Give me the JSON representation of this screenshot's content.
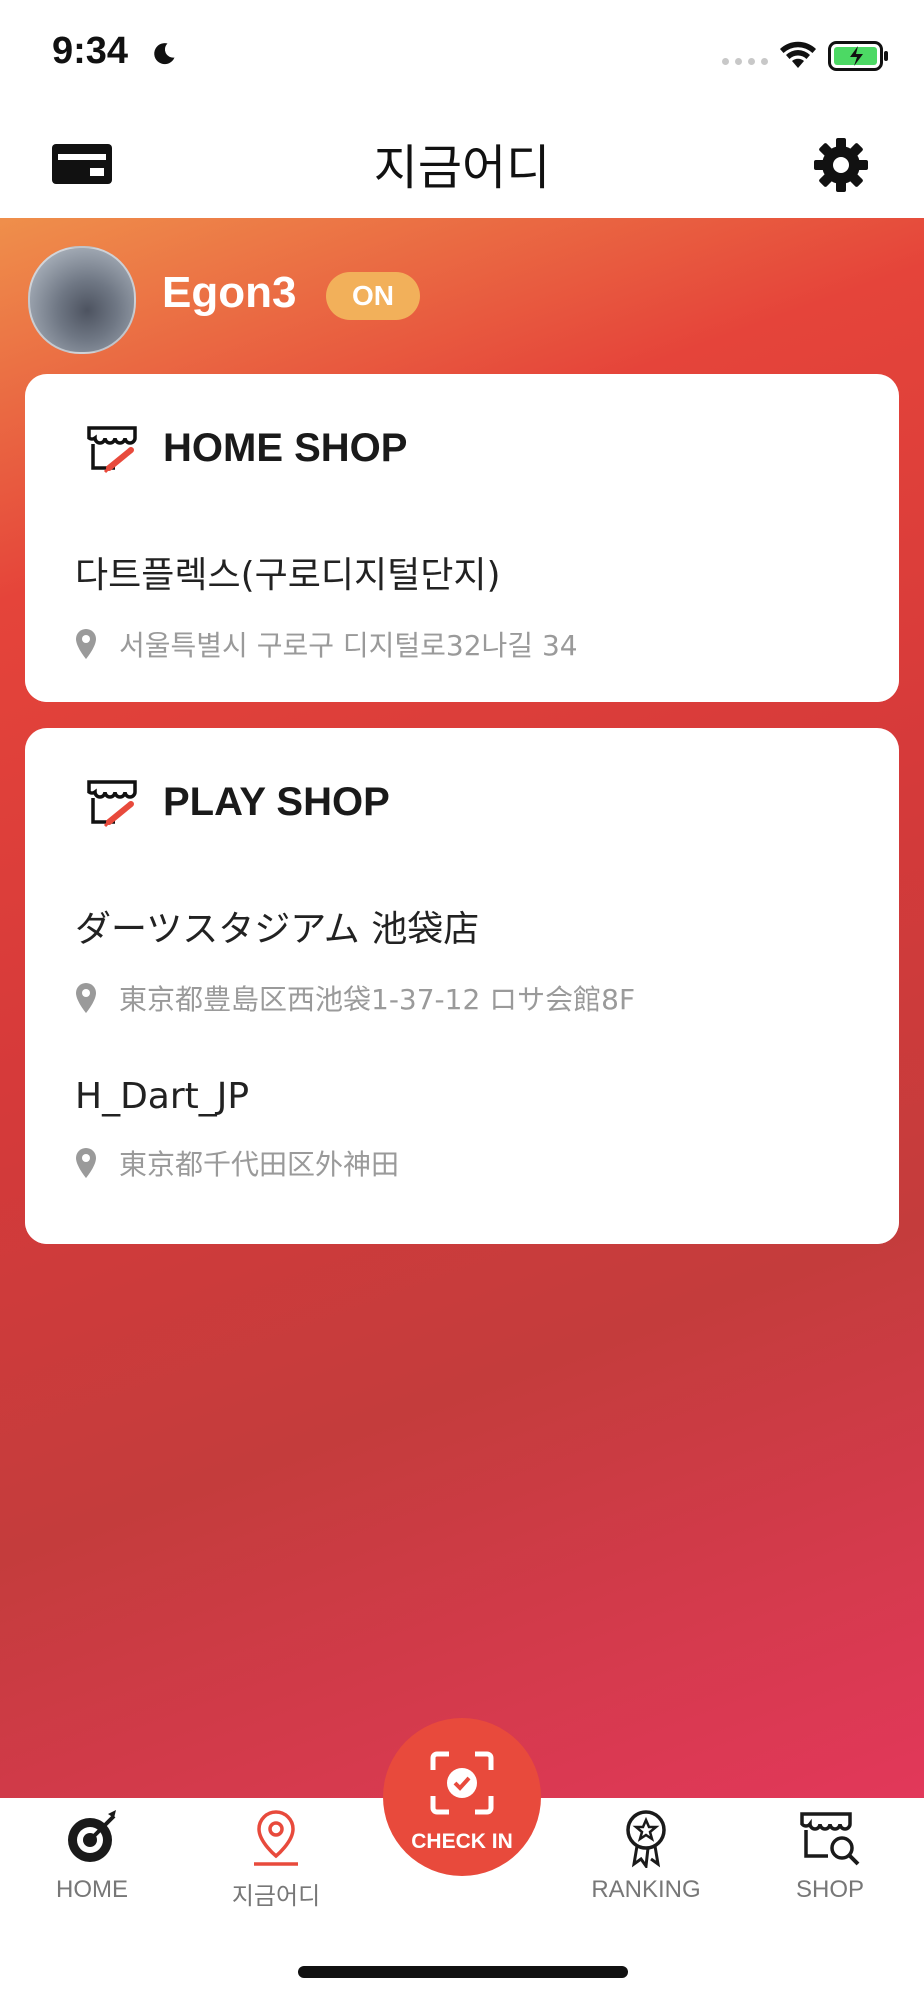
{
  "status_bar": {
    "time": "9:34"
  },
  "header": {
    "title": "지금어디"
  },
  "profile": {
    "username": "Egon3",
    "status_badge": "ON"
  },
  "home_shop": {
    "title": "HOME SHOP",
    "entries": [
      {
        "name": "다트플렉스(구로디지털단지)",
        "address": "서울특별시 구로구 디지털로32나길 34"
      }
    ]
  },
  "play_shop": {
    "title": "PLAY SHOP",
    "entries": [
      {
        "name": "ダーツスタジアム 池袋店",
        "address": "東京都豊島区西池袋1-37-12 ロサ会館8F"
      },
      {
        "name": "H_Dart_JP",
        "address": "東京都千代田区外神田"
      }
    ]
  },
  "bottom_nav": {
    "home": "HOME",
    "where": "지금어디",
    "checkin": "CHECK IN",
    "ranking": "RANKING",
    "shop": "SHOP"
  },
  "colors": {
    "accent": "#e84a3c",
    "badge": "#f2b05a",
    "active_nav": "#e84a3c"
  }
}
